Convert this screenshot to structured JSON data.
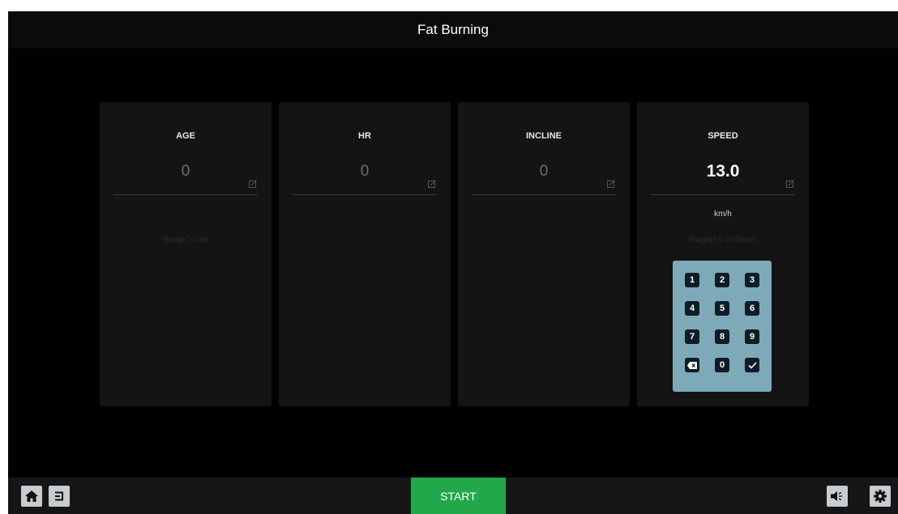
{
  "title": "Fat Burning",
  "cards": [
    {
      "label": "AGE",
      "value": "0",
      "unit": "",
      "range": "Range(10-99)",
      "icon": "edit-icon"
    },
    {
      "label": "HR",
      "value": "0",
      "unit": "",
      "range": "",
      "icon": "edit-icon"
    },
    {
      "label": "INCLINE",
      "value": "0",
      "unit": "",
      "range": "",
      "icon": "edit-icon"
    },
    {
      "label": "SPEED",
      "value": "13.0",
      "unit": "km/h",
      "range": "Range(0.5-20.0)km/h",
      "icon": "edit-icon"
    }
  ],
  "keypad": {
    "keys": [
      "1",
      "2",
      "3",
      "4",
      "5",
      "6",
      "7",
      "8",
      "9",
      "0"
    ],
    "backspace_icon": "backspace-icon",
    "confirm_icon": "check-icon"
  },
  "bottom": {
    "start_label": "START",
    "home_icon": "home-icon",
    "back_icon": "back-icon",
    "volume_icon": "volume-icon",
    "settings_icon": "gear-icon"
  },
  "colors": {
    "background": "#000000",
    "card": "#141414",
    "keypad": "#7ea9b9",
    "key": "#0c1d26",
    "start": "#22a84a"
  }
}
